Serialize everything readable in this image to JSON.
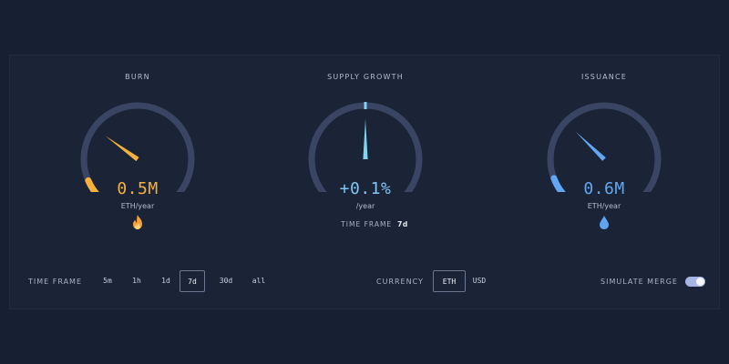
{
  "burn": {
    "title": "BURN",
    "value": "0.5M",
    "unit": "ETH/year",
    "icon": "fire-icon",
    "fill_fraction": 0.08,
    "needle_fraction": 0.3,
    "color": "#f6b03c"
  },
  "supply_growth": {
    "title": "SUPPLY GROWTH",
    "value": "+0.1%",
    "unit": "/year",
    "needle_fraction": 0.5,
    "color": "#7fd4f4",
    "time_frame_label": "TIME FRAME",
    "time_frame_value": "7d"
  },
  "issuance": {
    "title": "ISSUANCE",
    "value": "0.6M",
    "unit": "ETH/year",
    "icon": "droplet-icon",
    "fill_fraction": 0.09,
    "needle_fraction": 0.33,
    "color": "#62a7f5"
  },
  "controls": {
    "time_frame_label": "TIME FRAME",
    "time_frame_options": [
      "5m",
      "1h",
      "1d",
      "7d",
      "30d",
      "all"
    ],
    "time_frame_selected": "7d",
    "currency_label": "CURRENCY",
    "currency_options": [
      "ETH",
      "USD"
    ],
    "currency_selected": "ETH",
    "simulate_merge_label": "SIMULATE MERGE",
    "simulate_merge_on": true
  },
  "colors": {
    "background": "#172033",
    "panel": "#1a2436",
    "gauge_track": "#3a4563",
    "text_muted": "#b4bdcc"
  }
}
